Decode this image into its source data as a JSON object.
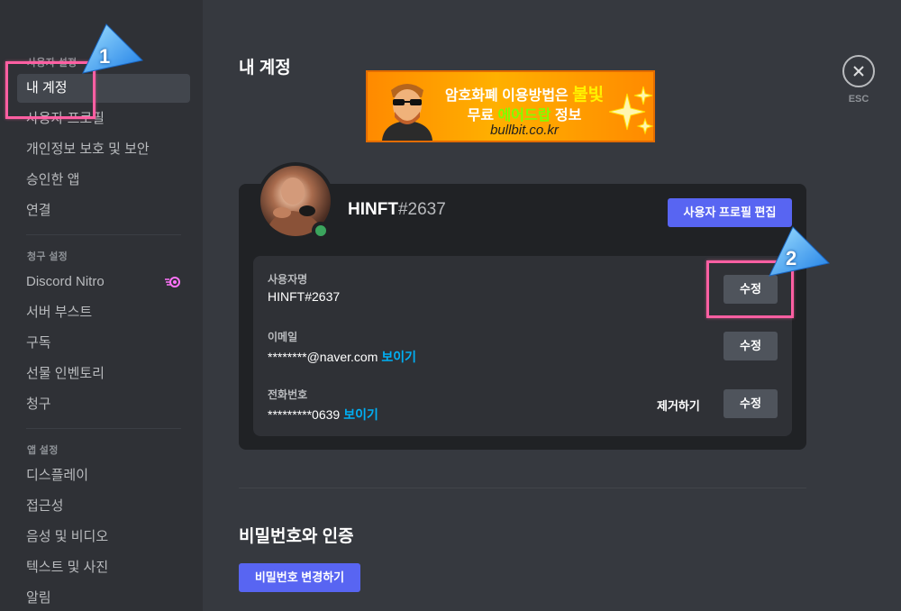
{
  "sidebar": {
    "user_settings_header": "사용자 설정",
    "user_items": [
      {
        "label": "내 계정"
      },
      {
        "label": "사용자 프로필"
      },
      {
        "label": "개인정보 보호 및 보안"
      },
      {
        "label": "승인한 앱"
      },
      {
        "label": "연결"
      }
    ],
    "billing_header": "청구 설정",
    "billing_items": [
      {
        "label": "Discord Nitro"
      },
      {
        "label": "서버 부스트"
      },
      {
        "label": "구독"
      },
      {
        "label": "선물 인벤토리"
      },
      {
        "label": "청구"
      }
    ],
    "app_header": "앱 설정",
    "app_items": [
      {
        "label": "디스플레이"
      },
      {
        "label": "접근성"
      },
      {
        "label": "음성 및 비디오"
      },
      {
        "label": "텍스트 및 사진"
      },
      {
        "label": "알림"
      }
    ]
  },
  "main": {
    "title": "내 계정",
    "esc_label": "ESC",
    "banner": {
      "line1_pre": "암호화폐 이용방법은 ",
      "line1_highlight": "불빛",
      "line2_pre": "무료 ",
      "line2_highlight": "에어드랍",
      "line2_post": " 정보",
      "line3": "bullbit.co.kr"
    },
    "profile": {
      "username": "HINFT",
      "tag": "#2637",
      "edit_profile_button": "사용자 프로필 편집"
    },
    "fields": {
      "username": {
        "label": "사용자명",
        "value": "HINFT#2637",
        "edit": "수정"
      },
      "email": {
        "label": "이메일",
        "value": "********@naver.com",
        "reveal": "보이기",
        "edit": "수정"
      },
      "phone": {
        "label": "전화번호",
        "value": "*********0639",
        "reveal": "보이기",
        "remove": "제거하기",
        "edit": "수정"
      }
    },
    "password_section": {
      "title": "비밀번호와 인증",
      "change_button": "비밀번호 변경하기"
    }
  },
  "annotations": {
    "step1": "1",
    "step2": "2"
  },
  "colors": {
    "background": "#36393f",
    "sidebar": "#2f3136",
    "card": "#202225",
    "accent": "#5865f2",
    "online": "#3ba55d",
    "link": "#00aff4",
    "highlight": "#ff5fa2"
  }
}
